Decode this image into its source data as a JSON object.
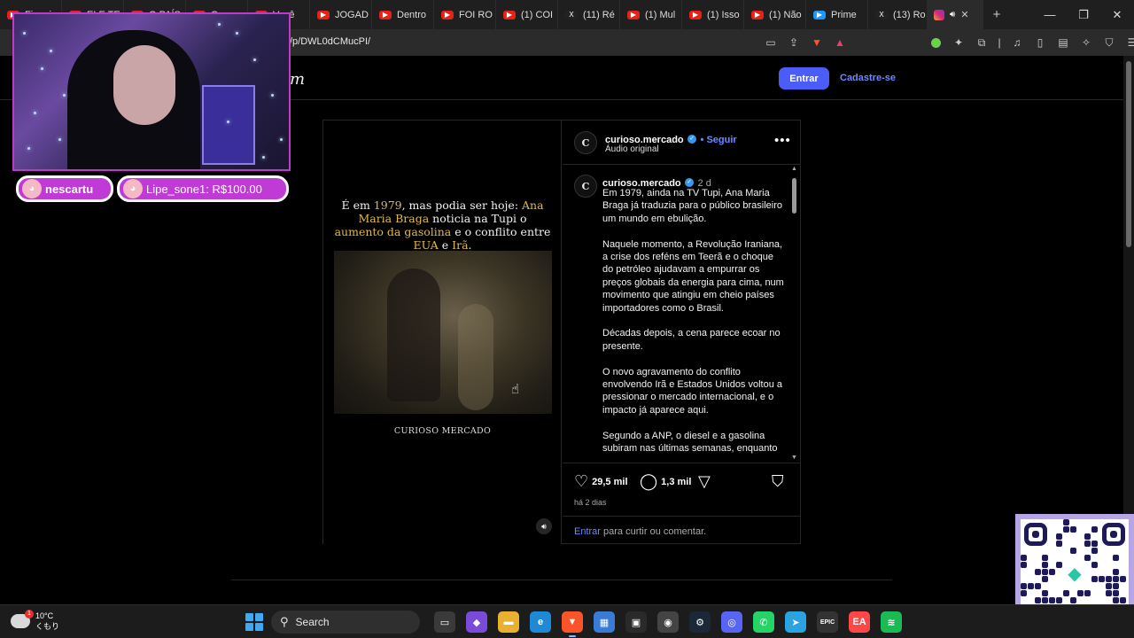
{
  "tabs": [
    {
      "label": "Finani",
      "color": "#e62117"
    },
    {
      "label": "ELE TE",
      "color": "#e62117"
    },
    {
      "label": "O PAÍS",
      "color": "#e62117"
    },
    {
      "label": "Como",
      "color": "#e62117"
    },
    {
      "label": "Você ",
      "color": "#e62117"
    },
    {
      "label": "JOGAD",
      "color": "#e62117"
    },
    {
      "label": "Dentro",
      "color": "#e62117"
    },
    {
      "label": "FOI RO",
      "color": "#e62117"
    },
    {
      "label": "(1) COI",
      "color": "#e62117"
    },
    {
      "label": "(11) Ré",
      "color": "#222222",
      "glyph": "X"
    },
    {
      "label": "(1) Mul",
      "color": "#e62117"
    },
    {
      "label": "(1) Isso",
      "color": "#e62117"
    },
    {
      "label": "(1) Não",
      "color": "#e62117"
    },
    {
      "label": "Prime",
      "color": "#1a98ff"
    },
    {
      "label": "(13) Ro",
      "color": "#222222",
      "glyph": "X"
    }
  ],
  "browser": {
    "url": "/p/DWL0dCMucPI/",
    "new_tab": "+",
    "minimize": "—",
    "restore": "❐",
    "close": "✕",
    "active_tab_close": "✕"
  },
  "site": {
    "logo_fragment": "m",
    "login_button": "Entrar",
    "signup_button": "Cadastre-se"
  },
  "post": {
    "media_caption_parts": [
      {
        "text": "É em ",
        "gold": false
      },
      {
        "text": "1979",
        "gold": true
      },
      {
        "text": ", mas podia ser hoje: ",
        "gold": false
      },
      {
        "text": "Ana Maria Braga",
        "gold": true
      },
      {
        "text": " noticia na Tupi o ",
        "gold": false
      },
      {
        "text": "aumento da gasolina",
        "gold": true
      },
      {
        "text": " e o conflito entre ",
        "gold": false
      },
      {
        "text": "EUA",
        "gold": true
      },
      {
        "text": " e ",
        "gold": false
      },
      {
        "text": "Irã",
        "gold": true
      },
      {
        "text": ".",
        "gold": false
      }
    ],
    "media_brand": "CURIOSO MERCADO",
    "username": "curioso.mercado",
    "follow": "• Seguir",
    "audio": "Áudio original",
    "avatar_letter": "C",
    "caption_age": "2 d",
    "caption_paragraphs": [
      "Em 1979, ainda na TV Tupi, Ana Maria Braga já traduzia para o público brasileiro um mundo em ebulição.",
      "Naquele momento, a Revolução Iraniana, a crise dos reféns em Teerã e o choque do petróleo ajudavam a empurrar os preços globais da energia para cima, num movimento que atingiu em cheio países importadores como o Brasil.",
      "Décadas depois, a cena parece ecoar no presente.",
      "O novo agravamento do conflito envolvendo Irã e Estados Unidos voltou a pressionar o mercado internacional, e o impacto já aparece aqui.",
      "Segundo a ANP, o diesel e a gasolina subiram nas últimas semanas, enquanto"
    ],
    "likes": "29,5 mil",
    "comments": "1,3 mil",
    "posted": "há 2 dias",
    "login_prompt_link": "Entrar",
    "login_prompt_text": " para curtir ou comentar."
  },
  "overlay": {
    "chat_user": "nescartu",
    "chat_donation": "Lipe_sone1: R$100.00"
  },
  "taskbar": {
    "temperature": "10°C",
    "weather_text": "くもり",
    "search_label": "Search",
    "apps": [
      {
        "name": "task-view",
        "color": "#3a3a3a",
        "glyph": "▭"
      },
      {
        "name": "copilot",
        "color": "#7a4ad8",
        "glyph": "◆"
      },
      {
        "name": "file-explorer",
        "color": "#e8b130",
        "glyph": "▬"
      },
      {
        "name": "edge",
        "color": "#1e8ad6",
        "glyph": "e"
      },
      {
        "name": "brave",
        "color": "#fb542b",
        "glyph": "▼"
      },
      {
        "name": "store",
        "color": "#3a7bd5",
        "glyph": "▦"
      },
      {
        "name": "app-black",
        "color": "#2a2a2a",
        "glyph": "▣"
      },
      {
        "name": "obs",
        "color": "#444444",
        "glyph": "◉"
      },
      {
        "name": "steam",
        "color": "#1b2838",
        "glyph": "⚙"
      },
      {
        "name": "discord",
        "color": "#5865f2",
        "glyph": "◎"
      },
      {
        "name": "whatsapp",
        "color": "#25d366",
        "glyph": "✆"
      },
      {
        "name": "telegram",
        "color": "#2aa3e0",
        "glyph": "➤"
      },
      {
        "name": "epic-games",
        "color": "#333333",
        "glyph": "EPIC"
      },
      {
        "name": "ea",
        "color": "#ff4747",
        "glyph": "EA"
      },
      {
        "name": "spotify",
        "color": "#1db954",
        "glyph": "≋"
      }
    ]
  }
}
